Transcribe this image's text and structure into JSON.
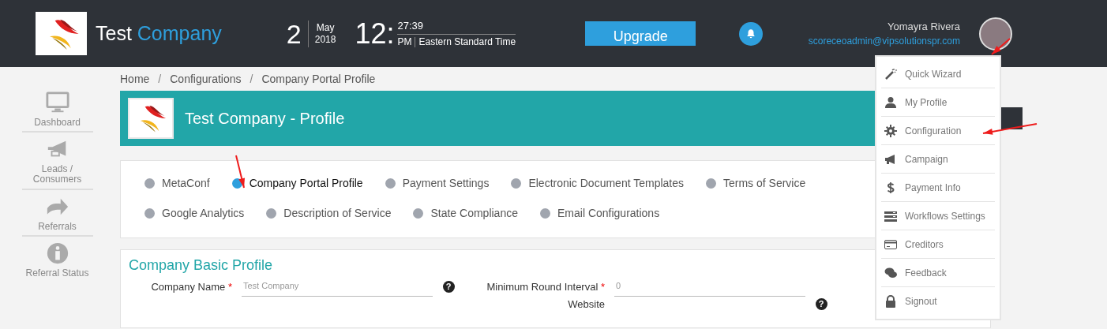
{
  "header": {
    "company_name": "Test",
    "company_name_accent": "Company",
    "date": {
      "day": "2",
      "month": "May",
      "year": "2018"
    },
    "time": {
      "hour": "12:",
      "minutes": "27:39",
      "meridiem": "PM",
      "timezone": "Eastern Standard Time"
    },
    "upgrade_button": "Upgrade",
    "user": {
      "name": "Yomayra Rivera",
      "email": "scoreceoadmin@vipsolutionspr.com"
    }
  },
  "sidebar": {
    "items": [
      {
        "label": "Dashboard",
        "kind": "monitor"
      },
      {
        "label": "Leads / Consumers",
        "kind": "megaphone"
      },
      {
        "label": "Referrals",
        "kind": "arrow"
      },
      {
        "label": "Referral Status",
        "kind": "info"
      }
    ]
  },
  "breadcrumb": [
    {
      "label": "Home"
    },
    {
      "separator": "/",
      "label": "Configurations"
    },
    {
      "separator": "/",
      "label": "Company Portal Profile"
    }
  ],
  "banner": {
    "title": "Test Company - Profile"
  },
  "config_tabs": [
    {
      "label": "MetaConf",
      "selected": false
    },
    {
      "label": "Company Portal Profile",
      "selected": true
    },
    {
      "label": "Payment Settings",
      "selected": false
    },
    {
      "label": "Electronic Document Templates",
      "selected": false
    },
    {
      "label": "Terms of Service",
      "selected": false
    },
    {
      "label": "Google Analytics",
      "selected": false
    },
    {
      "label": "Description of Service",
      "selected": false
    },
    {
      "label": "State Compliance",
      "selected": false
    },
    {
      "label": "Email Configurations",
      "selected": false
    }
  ],
  "form": {
    "title": "Company Basic Profile",
    "rows": [
      {
        "left": {
          "label": "Company Name",
          "required_mark": "*",
          "placeholder": "Test Company",
          "help_mark": "?"
        },
        "right": {
          "label": "Minimum Round Interval",
          "required_mark": "*",
          "placeholder": "0"
        }
      },
      {
        "right": {
          "label": "Website",
          "help_mark": "?"
        }
      }
    ]
  },
  "user_menu": [
    {
      "label": "Quick Wizard",
      "kind": "wand"
    },
    {
      "label": "My Profile",
      "kind": "user"
    },
    {
      "label": "Configuration",
      "kind": "gear"
    },
    {
      "label": "Campaign",
      "kind": "megaphone"
    },
    {
      "label": "Payment Info",
      "kind": "dollar"
    },
    {
      "label": "Workflows Settings",
      "kind": "list"
    },
    {
      "label": "Creditors",
      "kind": "card"
    },
    {
      "label": "Feedback",
      "kind": "chat"
    },
    {
      "label": "Signout",
      "kind": "lock"
    }
  ]
}
